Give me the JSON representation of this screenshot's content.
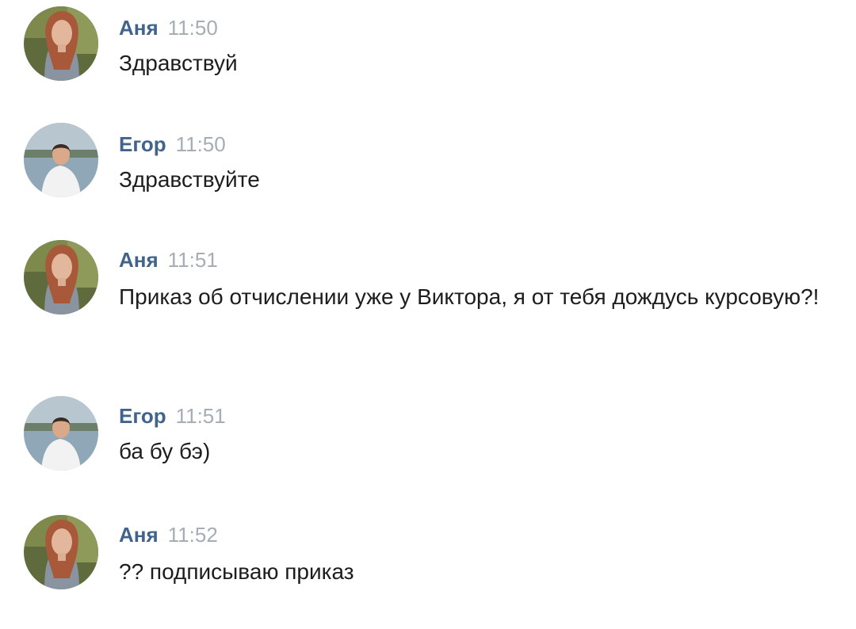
{
  "messages": [
    {
      "author": "Аня",
      "time": "11:50",
      "text": "Здравствуй",
      "avatar": "female-avatar"
    },
    {
      "author": "Егор",
      "time": "11:50",
      "text": "Здравствуйте",
      "avatar": "male-avatar"
    },
    {
      "author": "Аня",
      "time": "11:51",
      "text": "Приказ об отчислении уже у Виктора, я от тебя дождусь курсовую?!",
      "avatar": "female-avatar"
    },
    {
      "author": "Егор",
      "time": "11:51",
      "text": "ба бу бэ)",
      "avatar": "male-avatar"
    },
    {
      "author": "Аня",
      "time": "11:52",
      "text": "?? подписываю приказ",
      "avatar": "female-avatar"
    }
  ],
  "colors": {
    "author": "#42648b",
    "time": "#a6adb5",
    "text": "#1d1d1d",
    "background": "#ffffff"
  }
}
